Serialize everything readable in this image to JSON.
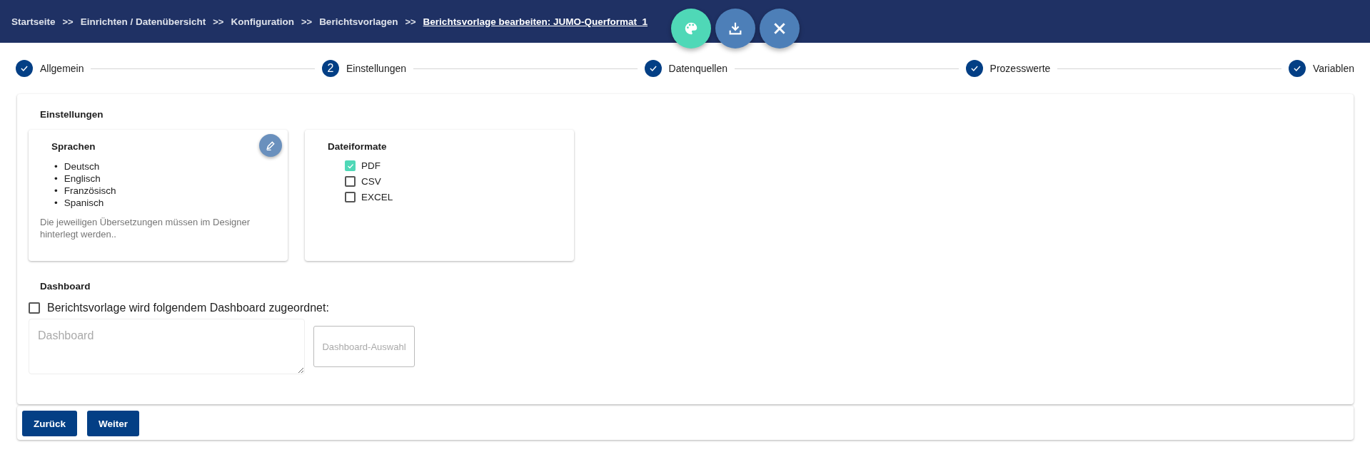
{
  "breadcrumb": [
    {
      "label": "Startseite",
      "current": false
    },
    {
      "label": "Einrichten / Datenübersicht",
      "current": false
    },
    {
      "label": "Konfiguration",
      "current": false
    },
    {
      "label": "Berichtsvorlagen",
      "current": false
    },
    {
      "label": "Berichtsvorlage bearbeiten: JUMO-Querformat_1",
      "current": true
    }
  ],
  "breadcrumb_separator": ">>",
  "fab_buttons": [
    {
      "kind": "palette"
    },
    {
      "kind": "download"
    },
    {
      "kind": "close"
    }
  ],
  "steps": [
    {
      "label": "Allgemein",
      "completed": true
    },
    {
      "label": "Einstellungen",
      "completed": false,
      "number": "2"
    },
    {
      "label": "Datenquellen",
      "completed": true
    },
    {
      "label": "Prozesswerte",
      "completed": true
    },
    {
      "label": "Variablen",
      "completed": true
    }
  ],
  "settings": {
    "title": "Einstellungen",
    "languages": {
      "title": "Sprachen",
      "bullet": "•",
      "items": [
        "Deutsch",
        "Englisch",
        "Französisch",
        "Spanisch"
      ],
      "note": "Die jeweiligen Übersetzungen müssen im Designer hinterlegt werden.."
    },
    "file_formats": {
      "title": "Dateiformate",
      "options": [
        {
          "label": "PDF",
          "checked": true
        },
        {
          "label": "CSV",
          "checked": false
        },
        {
          "label": "EXCEL",
          "checked": false
        }
      ]
    }
  },
  "dashboard": {
    "title": "Dashboard",
    "assign_label": "Berichtsvorlage wird folgendem Dashboard zugeordnet:",
    "assign_checked": false,
    "field_placeholder": "Dashboard",
    "select_button": "Dashboard-Auswahl"
  },
  "footer_buttons": [
    "Zurück",
    "Weiter"
  ]
}
